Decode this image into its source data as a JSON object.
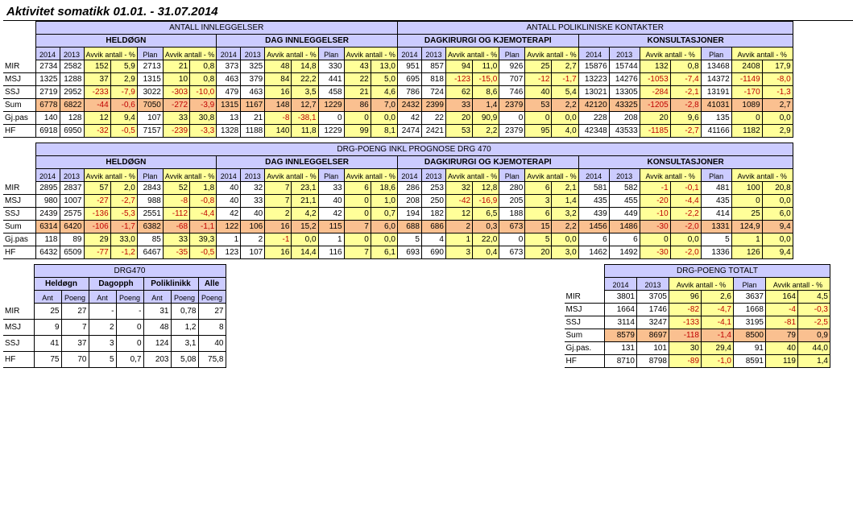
{
  "title": "Aktivitet somatikk 01.01. - 31.07.2014",
  "top_sections": [
    "ANTALL INNLEGGELSER",
    "ANTALL POLIKLINISKE KONTAKTER"
  ],
  "sub_sections": [
    "HELDØGN",
    "DAG INNLEGGELSER",
    "DAGKIRURGI OG KJEMOTERAPI",
    "KONSULTASJONER"
  ],
  "col_labels": {
    "y2014": "2014",
    "y2013": "2013",
    "avvik_antall": "Avvik antall - %",
    "plan": "Plan",
    "avvik_antall2": "Avvik antall - %",
    "avvik_antall_wide": "Avvik     antall - %"
  },
  "row_labels": [
    "MIR",
    "MSJ",
    "SSJ",
    "Sum",
    "Gj.pas",
    "HF"
  ],
  "block1": {
    "rows": [
      [
        "MIR",
        "2734",
        "2582",
        "152",
        "5,9",
        "2713",
        "21",
        "0,8",
        "373",
        "325",
        "48",
        "14,8",
        "330",
        "43",
        "13,0",
        "951",
        "857",
        "94",
        "11,0",
        "926",
        "25",
        "2,7",
        "15876",
        "15744",
        "132",
        "0,8",
        "13468",
        "2408",
        "17,9"
      ],
      [
        "MSJ",
        "1325",
        "1288",
        "37",
        "2,9",
        "1315",
        "10",
        "0,8",
        "463",
        "379",
        "84",
        "22,2",
        "441",
        "22",
        "5,0",
        "695",
        "818",
        "-123",
        "-15,0",
        "707",
        "-12",
        "-1,7",
        "13223",
        "14276",
        "-1053",
        "-7,4",
        "14372",
        "-1149",
        "-8,0"
      ],
      [
        "SSJ",
        "2719",
        "2952",
        "-233",
        "-7,9",
        "3022",
        "-303",
        "-10,0",
        "479",
        "463",
        "16",
        "3,5",
        "458",
        "21",
        "4,6",
        "786",
        "724",
        "62",
        "8,6",
        "746",
        "40",
        "5,4",
        "13021",
        "13305",
        "-284",
        "-2,1",
        "13191",
        "-170",
        "-1,3"
      ],
      [
        "Sum",
        "6778",
        "6822",
        "-44",
        "-0,6",
        "7050",
        "-272",
        "-3,9",
        "1315",
        "1167",
        "148",
        "12,7",
        "1229",
        "86",
        "7,0",
        "2432",
        "2399",
        "33",
        "1,4",
        "2379",
        "53",
        "2,2",
        "42120",
        "43325",
        "-1205",
        "-2,8",
        "41031",
        "1089",
        "2,7"
      ],
      [
        "Gj.pas",
        "140",
        "128",
        "12",
        "9,4",
        "107",
        "33",
        "30,8",
        "13",
        "21",
        "-8",
        "-38,1",
        "0",
        "0",
        "0,0",
        "42",
        "22",
        "20",
        "90,9",
        "0",
        "0",
        "0,0",
        "228",
        "208",
        "20",
        "9,6",
        "135",
        "0",
        "0,0"
      ],
      [
        "HF",
        "6918",
        "6950",
        "-32",
        "-0,5",
        "7157",
        "-239",
        "-3,3",
        "1328",
        "1188",
        "140",
        "11,8",
        "1229",
        "99",
        "8,1",
        "2474",
        "2421",
        "53",
        "2,2",
        "2379",
        "95",
        "4,0",
        "42348",
        "43533",
        "-1185",
        "-2,7",
        "41166",
        "1182",
        "2,9"
      ]
    ]
  },
  "block2": {
    "title": "DRG-POENG INKL PROGNOSE DRG 470",
    "rows": [
      [
        "MIR",
        "2895",
        "2837",
        "57",
        "2,0",
        "2843",
        "52",
        "1,8",
        "40",
        "32",
        "7",
        "23,1",
        "33",
        "6",
        "18,6",
        "286",
        "253",
        "32",
        "12,8",
        "280",
        "6",
        "2,1",
        "581",
        "582",
        "-1",
        "-0,1",
        "481",
        "100",
        "20,8"
      ],
      [
        "MSJ",
        "980",
        "1007",
        "-27",
        "-2,7",
        "988",
        "-8",
        "-0,8",
        "40",
        "33",
        "7",
        "21,1",
        "40",
        "0",
        "1,0",
        "208",
        "250",
        "-42",
        "-16,9",
        "205",
        "3",
        "1,4",
        "435",
        "455",
        "-20",
        "-4,4",
        "435",
        "0",
        "0,0"
      ],
      [
        "SSJ",
        "2439",
        "2575",
        "-136",
        "-5,3",
        "2551",
        "-112",
        "-4,4",
        "42",
        "40",
        "2",
        "4,2",
        "42",
        "0",
        "0,7",
        "194",
        "182",
        "12",
        "6,5",
        "188",
        "6",
        "3,2",
        "439",
        "449",
        "-10",
        "-2,2",
        "414",
        "25",
        "6,0"
      ],
      [
        "Sum",
        "6314",
        "6420",
        "-106",
        "-1,7",
        "6382",
        "-68",
        "-1,1",
        "122",
        "106",
        "16",
        "15,2",
        "115",
        "7",
        "6,0",
        "688",
        "686",
        "2",
        "0,3",
        "673",
        "15",
        "2,2",
        "1456",
        "1486",
        "-30",
        "-2,0",
        "1331",
        "124,9",
        "9,4"
      ],
      [
        "Gj.pas",
        "118",
        "89",
        "29",
        "33,0",
        "85",
        "33",
        "39,3",
        "1",
        "2",
        "-1",
        "0,0",
        "1",
        "0",
        "0,0",
        "5",
        "4",
        "1",
        "22,0",
        "0",
        "5",
        "0,0",
        "6",
        "6",
        "0",
        "0,0",
        "5",
        "1",
        "0,0"
      ],
      [
        "HF",
        "6432",
        "6509",
        "-77",
        "-1,2",
        "6467",
        "-35",
        "-0,5",
        "123",
        "107",
        "16",
        "14,4",
        "116",
        "7",
        "6,1",
        "693",
        "690",
        "3",
        "0,4",
        "673",
        "20",
        "3,0",
        "1462",
        "1492",
        "-30",
        "-2,0",
        "1336",
        "126",
        "9,4"
      ]
    ]
  },
  "drg470": {
    "title": "DRG470",
    "groups": [
      "Heldøgn",
      "Dagopph",
      "Poliklinikk",
      "Alle"
    ],
    "subcols": [
      "Ant",
      "Poeng",
      "Ant",
      "Poeng",
      "Ant",
      "Poeng",
      "Poeng"
    ],
    "rows": [
      [
        "MIR",
        "25",
        "27",
        "-",
        "-",
        "31",
        "0,78",
        "27"
      ],
      [
        "MSJ",
        "9",
        "7",
        "2",
        "0",
        "48",
        "1,2",
        "8"
      ],
      [
        "SSJ",
        "41",
        "37",
        "3",
        "0",
        "124",
        "3,1",
        "40"
      ],
      [
        "HF",
        "75",
        "70",
        "5",
        "0,7",
        "203",
        "5,08",
        "75,8"
      ]
    ]
  },
  "drg_total": {
    "title": "DRG-POENG TOTALT",
    "cols": [
      "2014",
      "2013",
      "Avvik antall - %",
      "Plan",
      "Avvik antall - %"
    ],
    "rows": [
      [
        "MIR",
        "3801",
        "3705",
        "96",
        "2,6",
        "3637",
        "164",
        "4,5"
      ],
      [
        "MSJ",
        "1664",
        "1746",
        "-82",
        "-4,7",
        "1668",
        "-4",
        "-0,3"
      ],
      [
        "SSJ",
        "3114",
        "3247",
        "-133",
        "-4,1",
        "3195",
        "-81",
        "-2,5"
      ],
      [
        "Sum",
        "8579",
        "8697",
        "-118",
        "-1,4",
        "8500",
        "79",
        "0,9"
      ],
      [
        "Gj.pas.",
        "131",
        "101",
        "30",
        "29,4",
        "91",
        "40",
        "44,0"
      ],
      [
        "HF",
        "8710",
        "8798",
        "-89",
        "-1,0",
        "8591",
        "119",
        "1,4"
      ]
    ]
  }
}
